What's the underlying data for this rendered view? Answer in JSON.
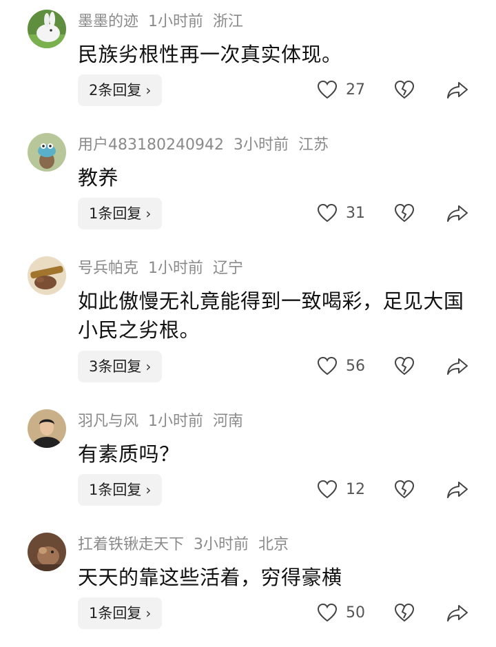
{
  "comments": [
    {
      "username": "墨墨的迹",
      "time": "1小时前",
      "location": "浙江",
      "text": "民族劣根性再一次真实体现。",
      "reply_label": "2条回复",
      "likes": "27",
      "avatar_icon": "rabbit-avatar"
    },
    {
      "username": "用户483180240942",
      "time": "3小时前",
      "location": "江苏",
      "text": "教养",
      "reply_label": "1条回复",
      "likes": "31",
      "avatar_icon": "cartoon-avatar"
    },
    {
      "username": "号兵帕克",
      "time": "1小时前",
      "location": "辽宁",
      "text": "如此傲慢无礼竟能得到一致喝彩，足见大国小民之劣根。",
      "reply_label": "3条回复",
      "likes": "56",
      "avatar_icon": "hand-avatar"
    },
    {
      "username": "羽凡与风",
      "time": "1小时前",
      "location": "河南",
      "text": "有素质吗？",
      "reply_label": "1条回复",
      "likes": "12",
      "avatar_icon": "person-avatar"
    },
    {
      "username": "扛着铁锹走天下",
      "time": "3小时前",
      "location": "北京",
      "text": "天天的靠这些活着，穷得豪横",
      "reply_label": "1条回复",
      "likes": "50",
      "avatar_icon": "animal-avatar"
    }
  ],
  "colors": {
    "meta": "#8a8a8a",
    "text": "#111111",
    "reply_bg": "#f2f2f2",
    "icon": "#444444"
  }
}
